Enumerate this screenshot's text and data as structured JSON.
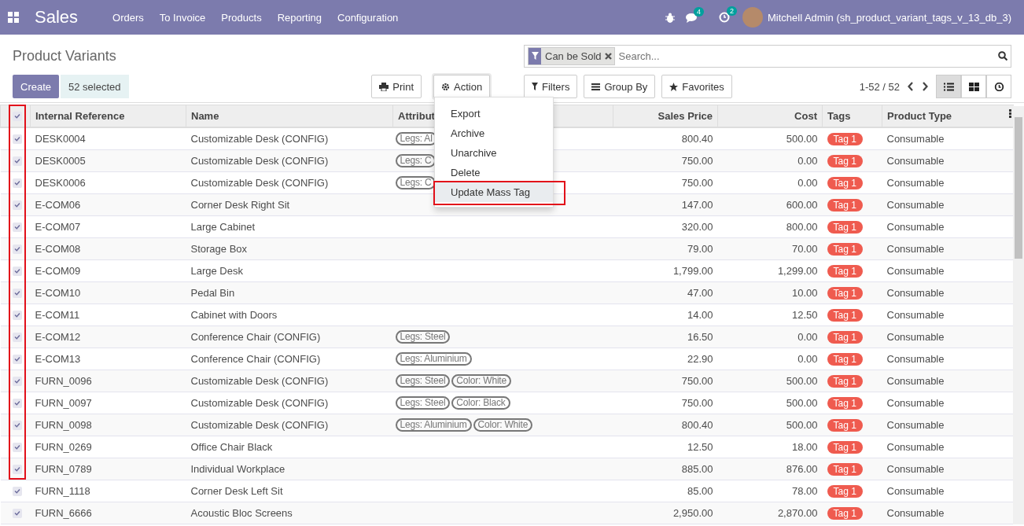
{
  "navbar": {
    "app": "Sales",
    "menu": [
      "Orders",
      "To Invoice",
      "Products",
      "Reporting",
      "Configuration"
    ],
    "messages_count": "4",
    "activities_count": "2",
    "user": "Mitchell Admin (sh_product_variant_tags_v_13_db_3)"
  },
  "control_panel": {
    "title": "Product Variants",
    "create": "Create",
    "selection": "52 selected",
    "print": "Print",
    "action": "Action",
    "facet": "Can be Sold",
    "search_placeholder": "Search...",
    "filters": "Filters",
    "group_by": "Group By",
    "favorites": "Favorites",
    "pager": "1-52 / 52",
    "views": [
      {
        "kind": "list",
        "selected": true
      },
      {
        "kind": "kanban",
        "selected": false
      },
      {
        "kind": "activity",
        "selected": false
      }
    ]
  },
  "action_menu": {
    "items": [
      {
        "label": "Export",
        "selected": false
      },
      {
        "label": "Archive",
        "selected": false
      },
      {
        "label": "Unarchive",
        "selected": false
      },
      {
        "label": "Delete",
        "selected": false
      },
      {
        "label": "Update Mass Tag",
        "selected": true
      }
    ]
  },
  "table": {
    "all_checked": true,
    "columns": [
      "Internal Reference",
      "Name",
      "Attribut",
      "Sales Price",
      "Cost",
      "Tags",
      "Product Type"
    ],
    "rows": [
      {
        "checked": true,
        "ref": "DESK0004",
        "name": "Customizable Desk (CONFIG)",
        "attributes": [
          "Legs: Al"
        ],
        "price": "800.40",
        "cost": "500.00",
        "tag": "Tag 1",
        "type": "Consumable"
      },
      {
        "checked": true,
        "ref": "DESK0005",
        "name": "Customizable Desk (CONFIG)",
        "attributes": [
          "Legs: C"
        ],
        "price": "750.00",
        "cost": "0.00",
        "tag": "Tag 1",
        "type": "Consumable"
      },
      {
        "checked": true,
        "ref": "DESK0006",
        "name": "Customizable Desk (CONFIG)",
        "attributes": [
          "Legs: C"
        ],
        "price": "750.00",
        "cost": "0.00",
        "tag": "Tag 1",
        "type": "Consumable"
      },
      {
        "checked": true,
        "ref": "E-COM06",
        "name": "Corner Desk Right Sit",
        "attributes": [],
        "price": "147.00",
        "cost": "600.00",
        "tag": "Tag 1",
        "type": "Consumable"
      },
      {
        "checked": true,
        "ref": "E-COM07",
        "name": "Large Cabinet",
        "attributes": [],
        "price": "320.00",
        "cost": "800.00",
        "tag": "Tag 1",
        "type": "Consumable"
      },
      {
        "checked": true,
        "ref": "E-COM08",
        "name": "Storage Box",
        "attributes": [],
        "price": "79.00",
        "cost": "70.00",
        "tag": "Tag 1",
        "type": "Consumable"
      },
      {
        "checked": true,
        "ref": "E-COM09",
        "name": "Large Desk",
        "attributes": [],
        "price": "1,799.00",
        "cost": "1,299.00",
        "tag": "Tag 1",
        "type": "Consumable"
      },
      {
        "checked": true,
        "ref": "E-COM10",
        "name": "Pedal Bin",
        "attributes": [],
        "price": "47.00",
        "cost": "10.00",
        "tag": "Tag 1",
        "type": "Consumable"
      },
      {
        "checked": true,
        "ref": "E-COM11",
        "name": "Cabinet with Doors",
        "attributes": [],
        "price": "14.00",
        "cost": "12.50",
        "tag": "Tag 1",
        "type": "Consumable"
      },
      {
        "checked": true,
        "ref": "E-COM12",
        "name": "Conference Chair (CONFIG)",
        "attributes": [
          "Legs: Steel"
        ],
        "price": "16.50",
        "cost": "0.00",
        "tag": "Tag 1",
        "type": "Consumable"
      },
      {
        "checked": true,
        "ref": "E-COM13",
        "name": "Conference Chair (CONFIG)",
        "attributes": [
          "Legs: Aluminium"
        ],
        "price": "22.90",
        "cost": "0.00",
        "tag": "Tag 1",
        "type": "Consumable"
      },
      {
        "checked": true,
        "ref": "FURN_0096",
        "name": "Customizable Desk (CONFIG)",
        "attributes": [
          "Legs: Steel",
          "Color: White"
        ],
        "price": "750.00",
        "cost": "500.00",
        "tag": "Tag 1",
        "type": "Consumable"
      },
      {
        "checked": true,
        "ref": "FURN_0097",
        "name": "Customizable Desk (CONFIG)",
        "attributes": [
          "Legs: Steel",
          "Color: Black"
        ],
        "price": "750.00",
        "cost": "500.00",
        "tag": "Tag 1",
        "type": "Consumable"
      },
      {
        "checked": true,
        "ref": "FURN_0098",
        "name": "Customizable Desk (CONFIG)",
        "attributes": [
          "Legs: Aluminium",
          "Color: White"
        ],
        "price": "800.40",
        "cost": "500.00",
        "tag": "Tag 1",
        "type": "Consumable"
      },
      {
        "checked": true,
        "ref": "FURN_0269",
        "name": "Office Chair Black",
        "attributes": [],
        "price": "12.50",
        "cost": "18.00",
        "tag": "Tag 1",
        "type": "Consumable"
      },
      {
        "checked": true,
        "ref": "FURN_0789",
        "name": "Individual Workplace",
        "attributes": [],
        "price": "885.00",
        "cost": "876.00",
        "tag": "Tag 1",
        "type": "Consumable"
      },
      {
        "checked": true,
        "ref": "FURN_1118",
        "name": "Corner Desk Left Sit",
        "attributes": [],
        "price": "85.00",
        "cost": "78.00",
        "tag": "Tag 1",
        "type": "Consumable"
      },
      {
        "checked": true,
        "ref": "FURN_6666",
        "name": "Acoustic Bloc Screens",
        "attributes": [],
        "price": "2,950.00",
        "cost": "2,870.00",
        "tag": "Tag 1",
        "type": "Consumable"
      }
    ]
  }
}
